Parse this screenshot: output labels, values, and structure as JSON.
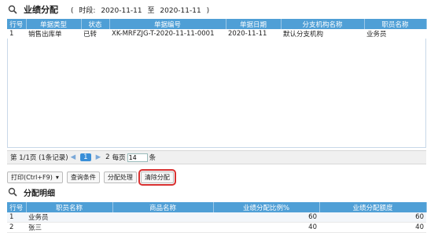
{
  "header": {
    "title": "业绩分配",
    "open_paren": "(",
    "date_label": "时段:",
    "date_from": "2020-11-11",
    "date_sep": "至",
    "date_to": "2020-11-11",
    "close_paren": ")"
  },
  "doc_table": {
    "columns": [
      "行号",
      "单据类型",
      "状态",
      "单据编号",
      "单据日期",
      "分支机构名称",
      "职员名称"
    ],
    "rows": [
      {
        "no": "1",
        "type": "销售出库单",
        "status": "已转",
        "code": "XK-MRFZJG-T-2020-11-11-0001",
        "date": "2020-11-11",
        "branch": "默认分支机构",
        "staff": "业务员"
      }
    ]
  },
  "pager": {
    "page_info": "第 1/1页 (1条记录)",
    "first": "◀",
    "prev": "◀",
    "current": "1",
    "next": "▶",
    "last": "2",
    "per_page_label": "每页",
    "per_page_value": "14",
    "per_page_unit": "条"
  },
  "toolbar": {
    "print": "打印(Ctrl+F9)",
    "print_arrow": "▾",
    "query": "查询条件",
    "allocate": "分配处理",
    "clear": "清除分配"
  },
  "section2": {
    "title": "分配明细"
  },
  "detail_table": {
    "columns": [
      "行号",
      "职员名称",
      "商品名称",
      "业绩分配比例%",
      "业绩分配额度"
    ],
    "rows": [
      {
        "no": "1",
        "staff": "业务员",
        "product": "",
        "ratio": "60",
        "amount": "60"
      },
      {
        "no": "2",
        "staff": "张三",
        "product": "",
        "ratio": "40",
        "amount": "40"
      }
    ]
  },
  "colors": {
    "header_blue": "#4f9fd6",
    "highlight_red": "#d83030"
  }
}
